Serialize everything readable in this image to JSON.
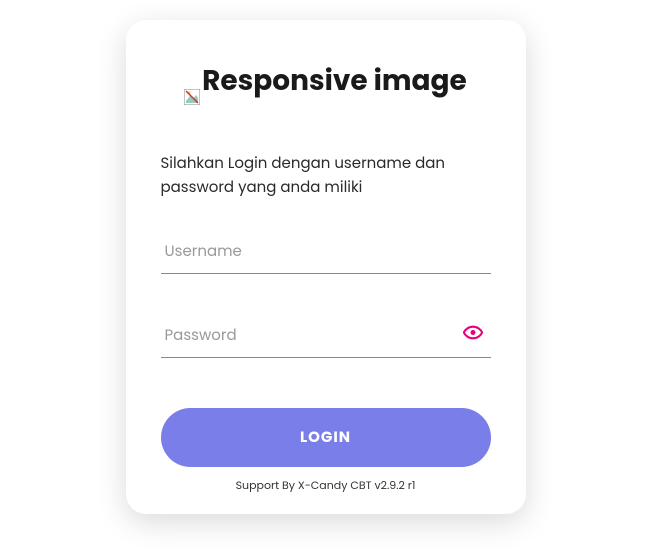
{
  "logo": {
    "alt_text": "Responsive image"
  },
  "instruction": "Silahkan Login dengan username dan password yang anda miliki",
  "form": {
    "username": {
      "placeholder": "Username",
      "value": ""
    },
    "password": {
      "placeholder": "Password",
      "value": ""
    },
    "submit_label": "LOGIN"
  },
  "footer": {
    "support_text": "Support By X-Candy CBT v2.9.2 r1"
  },
  "colors": {
    "accent_button": "#7a7ee8",
    "eye_icon": "#e6007e"
  }
}
